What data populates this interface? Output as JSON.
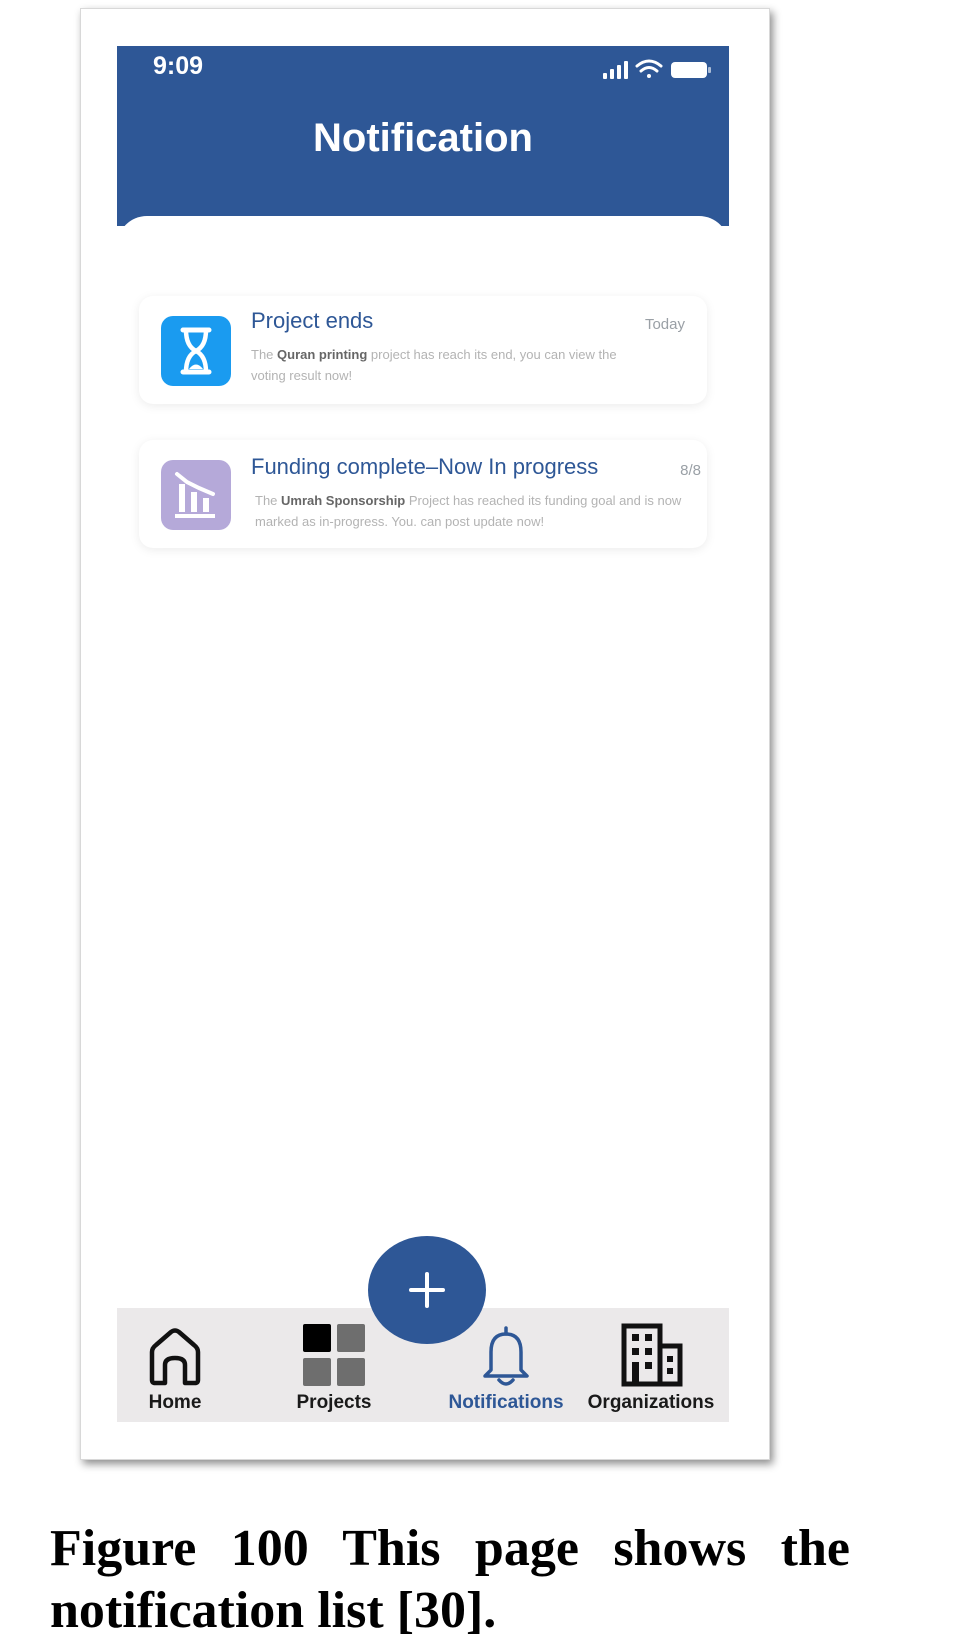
{
  "status_bar": {
    "time": "9:09",
    "icons": [
      "signal-icon",
      "wifi-icon",
      "battery-icon"
    ]
  },
  "header": {
    "title": "Notification"
  },
  "notifications": [
    {
      "icon": "hourglass-icon",
      "icon_color": "#1a9bf0",
      "title": "Project ends",
      "date": "Today",
      "body_prefix": "The ",
      "body_bold": "Quran printing",
      "body_suffix": " project has reach its end, you can view the voting result now!"
    },
    {
      "icon": "chart-icon",
      "icon_color": "#b5a9d9",
      "title": "Funding complete–Now In progress",
      "date": "8/8",
      "body_prefix": "The ",
      "body_bold": "Umrah Sponsorship",
      "body_suffix": " Project has reached its funding goal and is now marked as in-progress. You. can post update now!"
    }
  ],
  "fab": {
    "icon": "plus-icon"
  },
  "bottom_nav": {
    "items": [
      {
        "label": "Home",
        "icon": "home-icon",
        "active": false
      },
      {
        "label": "Projects",
        "icon": "grid-icon",
        "active": false
      },
      {
        "label": "Notifications",
        "icon": "bell-icon",
        "active": true
      },
      {
        "label": "Organizations",
        "icon": "building-icon",
        "active": false
      }
    ]
  },
  "colors": {
    "primary": "#2e5796",
    "nav_background": "#ebe9ea",
    "muted_text": "#b3b3b3"
  },
  "caption": {
    "text": "Figure 100 This page shows the notification list [30]."
  }
}
